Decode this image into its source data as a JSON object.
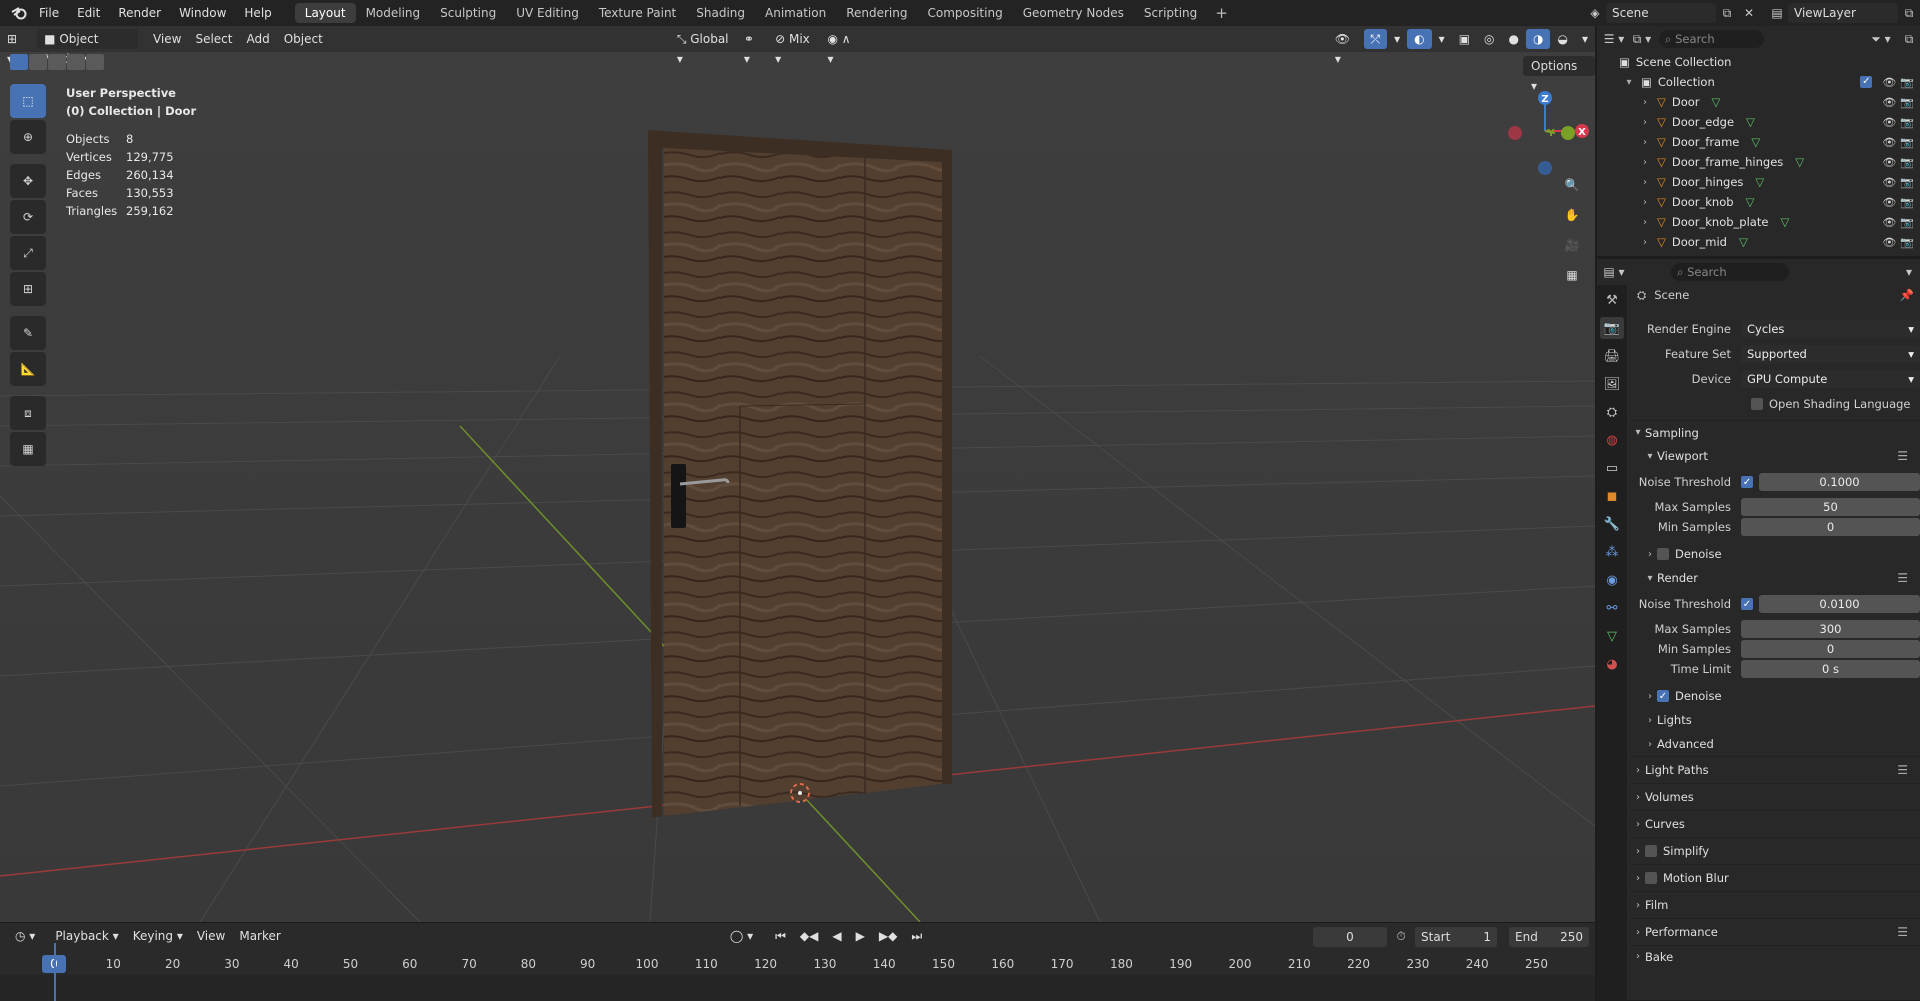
{
  "topbar": {
    "menus": [
      "File",
      "Edit",
      "Render",
      "Window",
      "Help"
    ],
    "workspaces": [
      "Layout",
      "Modeling",
      "Sculpting",
      "UV Editing",
      "Texture Paint",
      "Shading",
      "Animation",
      "Rendering",
      "Compositing",
      "Geometry Nodes",
      "Scripting"
    ],
    "active_workspace": "Layout",
    "scene_name": "Scene",
    "view_layer": "ViewLayer"
  },
  "viewport": {
    "mode": "Object Mode",
    "menus": [
      "View",
      "Select",
      "Add",
      "Object"
    ],
    "orientation": "Global",
    "snap_mode": "Mix",
    "options_label": "Options",
    "perspective": "User Perspective",
    "collection_info": "(0) Collection | Door",
    "stats": [
      {
        "label": "Objects",
        "value": "8"
      },
      {
        "label": "Vertices",
        "value": "129,775"
      },
      {
        "label": "Edges",
        "value": "260,134"
      },
      {
        "label": "Faces",
        "value": "130,553"
      },
      {
        "label": "Triangles",
        "value": "259,162"
      }
    ],
    "gizmo": {
      "x_label": "X",
      "y_label": "Y",
      "z_label": "Z"
    }
  },
  "timeline": {
    "menus": [
      "Playback",
      "Keying",
      "View",
      "Marker"
    ],
    "current_frame": "0",
    "start_label": "Start",
    "start": "1",
    "end_label": "End",
    "end": "250",
    "ruler": [
      "0",
      "10",
      "20",
      "30",
      "40",
      "50",
      "60",
      "70",
      "80",
      "90",
      "100",
      "110",
      "120",
      "130",
      "140",
      "150",
      "160",
      "170",
      "180",
      "190",
      "200",
      "210",
      "220",
      "230",
      "240",
      "250"
    ]
  },
  "outliner": {
    "search_placeholder": "Search",
    "scene_collection": "Scene Collection",
    "collection": "Collection",
    "objects": [
      "Door",
      "Door_edge",
      "Door_frame",
      "Door_frame_hinges",
      "Door_hinges",
      "Door_knob",
      "Door_knob_plate",
      "Door_mid"
    ]
  },
  "properties": {
    "search_placeholder": "Search",
    "context": "Scene",
    "render_engine_label": "Render Engine",
    "render_engine": "Cycles",
    "feature_set_label": "Feature Set",
    "feature_set": "Supported",
    "device_label": "Device",
    "device": "GPU Compute",
    "osl_label": "Open Shading Language",
    "sampling": "Sampling",
    "viewport": "Viewport",
    "noise_threshold_label": "Noise Threshold",
    "vp_noise_threshold": "0.1000",
    "max_samples_label": "Max Samples",
    "vp_max_samples": "50",
    "min_samples_label": "Min Samples",
    "vp_min_samples": "0",
    "denoise_label": "Denoise",
    "render": "Render",
    "r_noise_threshold": "0.0100",
    "r_max_samples": "300",
    "r_min_samples": "0",
    "time_limit_label": "Time Limit",
    "time_limit": "0 s",
    "lights": "Lights",
    "advanced": "Advanced",
    "light_paths": "Light Paths",
    "volumes": "Volumes",
    "curves": "Curves",
    "simplify": "Simplify",
    "motion_blur": "Motion Blur",
    "film": "Film",
    "performance": "Performance",
    "bake": "Bake"
  }
}
